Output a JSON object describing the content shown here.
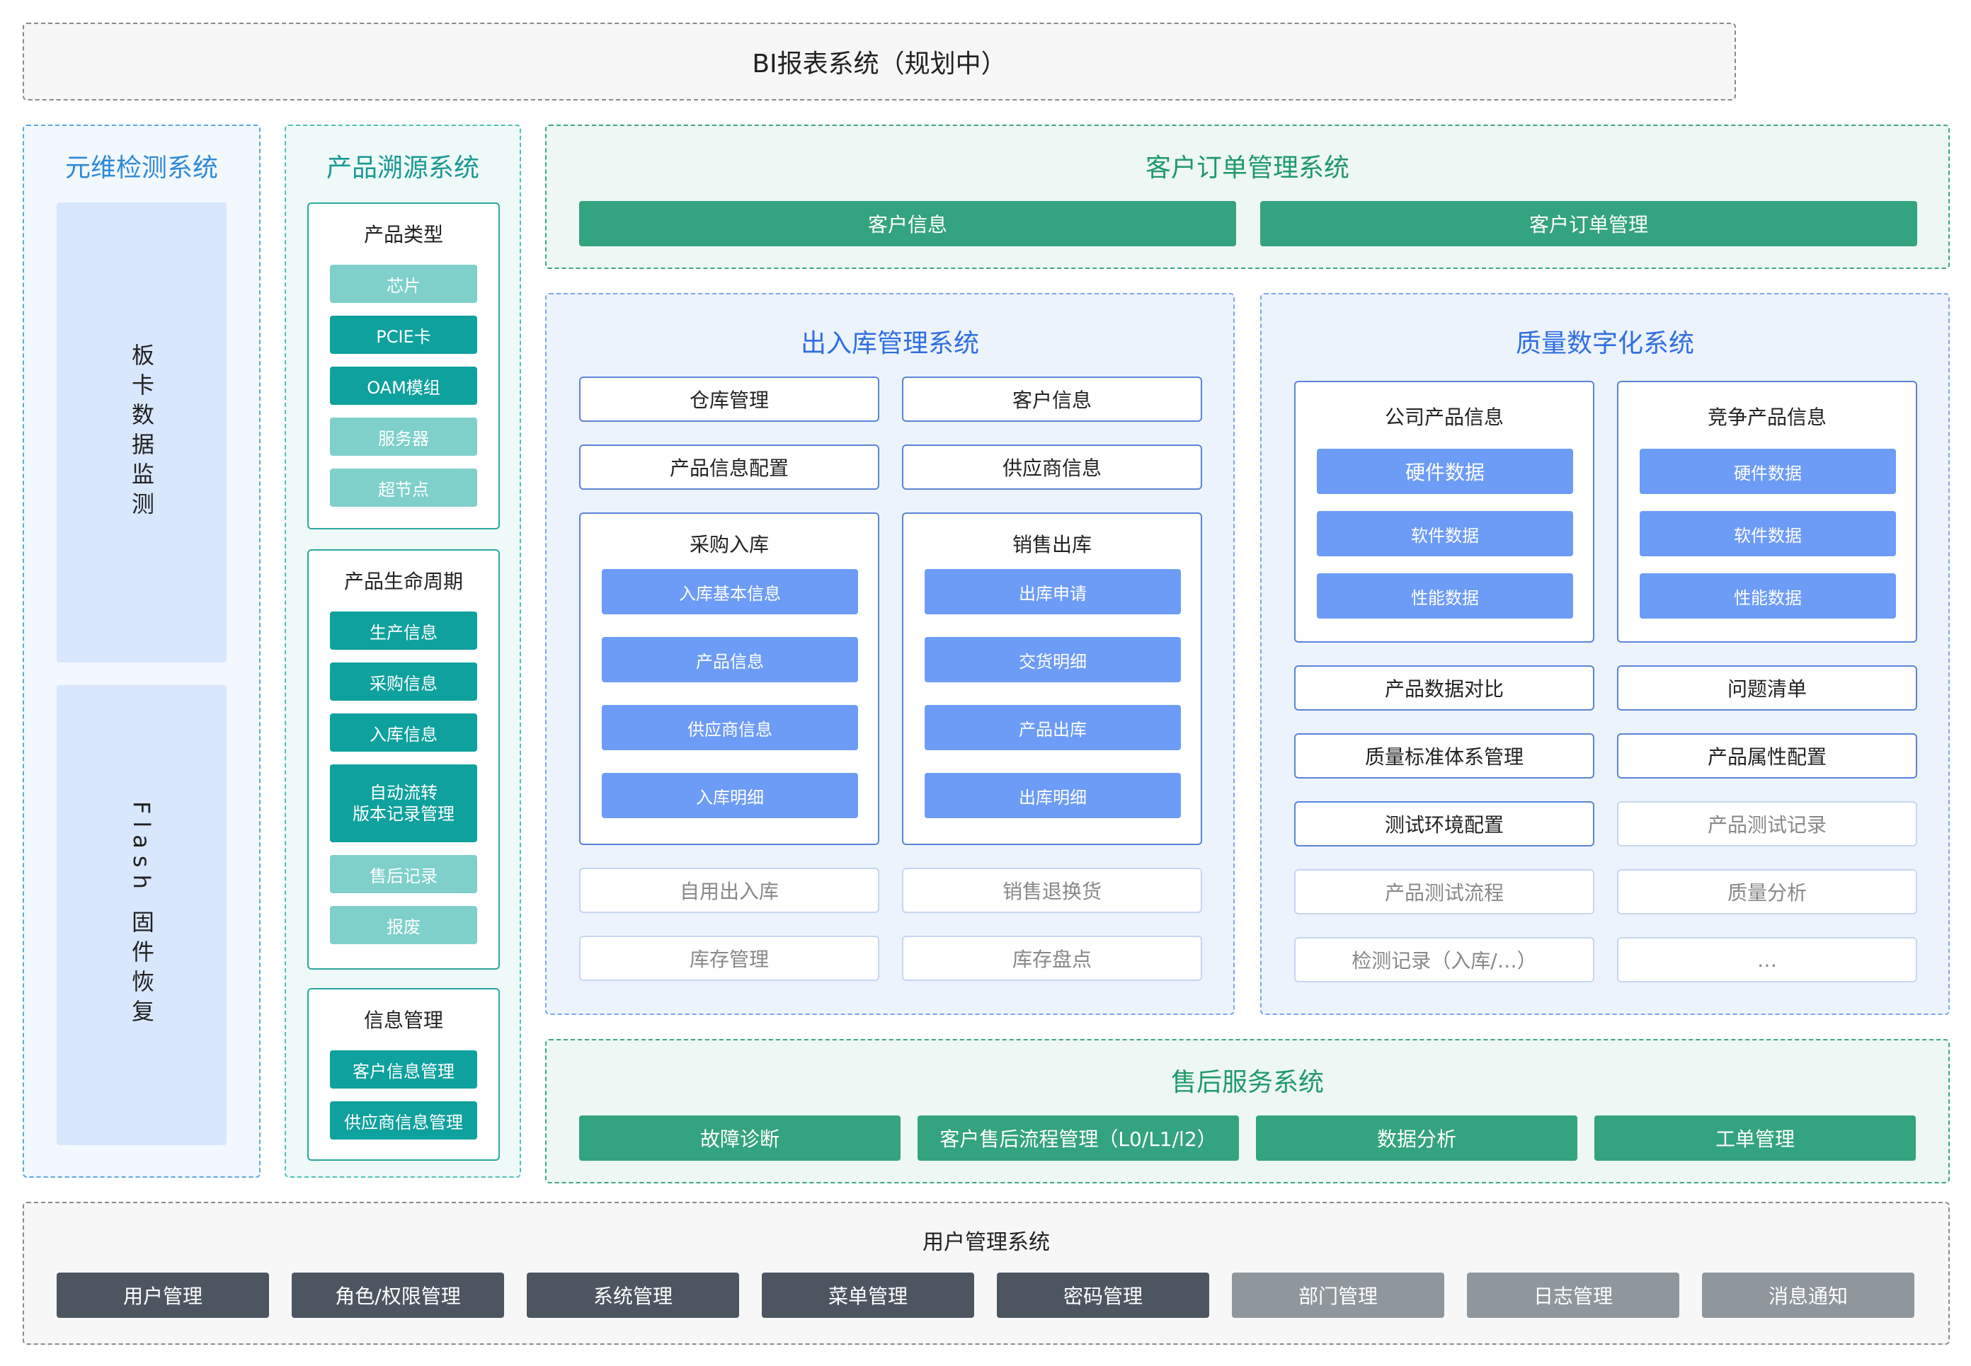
{
  "bi": {
    "title": "BI报表系统（规划中）"
  },
  "ops": {
    "title": "元维检测系统",
    "items": [
      "板卡数据监测",
      "Flash 固件恢复"
    ]
  },
  "trace": {
    "title": "产品溯源系统",
    "groups": [
      {
        "title": "产品类型",
        "items": [
          "芯片",
          "PCIE卡",
          "OAM模组",
          "服务器",
          "超节点"
        ]
      },
      {
        "title": "产品生命周期",
        "items": [
          "生产信息",
          "采购信息",
          "入库信息",
          "自动流转\n版本记录管理",
          "售后记录",
          "报废"
        ]
      },
      {
        "title": "信息管理",
        "items": [
          "客户信息管理",
          "供应商信息管理"
        ]
      }
    ]
  },
  "order": {
    "title": "客户订单管理系统",
    "items": [
      "客户信息",
      "客户订单管理"
    ]
  },
  "warehouse": {
    "title": "出入库管理系统",
    "top": [
      "仓库管理",
      "客户信息",
      "产品信息配置",
      "供应商信息"
    ],
    "purchase": {
      "title": "采购入库",
      "items": [
        "入库基本信息",
        "产品信息",
        "供应商信息",
        "入库明细"
      ]
    },
    "sales": {
      "title": "销售出库",
      "items": [
        "出库申请",
        "交货明细",
        "产品出库",
        "出库明细"
      ]
    },
    "planned": [
      "自用出入库",
      "销售退换货",
      "库存管理",
      "库存盘点"
    ]
  },
  "quality": {
    "title": "质量数字化系统",
    "company": {
      "title": "公司产品信息",
      "items": [
        "硬件数据",
        "软件数据",
        "性能数据"
      ]
    },
    "competitor": {
      "title": "竞争产品信息",
      "items": [
        "硬件数据",
        "软件数据",
        "性能数据"
      ]
    },
    "active": [
      "产品数据对比",
      "问题清单",
      "质量标准体系管理",
      "产品属性配置",
      "测试环境配置"
    ],
    "planned": [
      "产品测试记录",
      "产品测试流程",
      "质量分析",
      "检测记录（入库/…）",
      "…"
    ]
  },
  "aftersales": {
    "title": "售后服务系统",
    "items": [
      "故障诊断",
      "客户售后流程管理（L0/L1/l2）",
      "数据分析",
      "工单管理"
    ]
  },
  "users": {
    "title": "用户管理系统",
    "active": [
      "用户管理",
      "角色/权限管理",
      "系统管理",
      "菜单管理",
      "密码管理"
    ],
    "planned": [
      "部门管理",
      "日志管理",
      "消息通知"
    ]
  },
  "colors": {
    "green": "#34a37f",
    "blue": "#6d9cf7",
    "teal_dark": "#0fa19d",
    "teal_light": "#7fd0cb",
    "slate": "#4d5660",
    "slate_light": "#8f969c"
  }
}
